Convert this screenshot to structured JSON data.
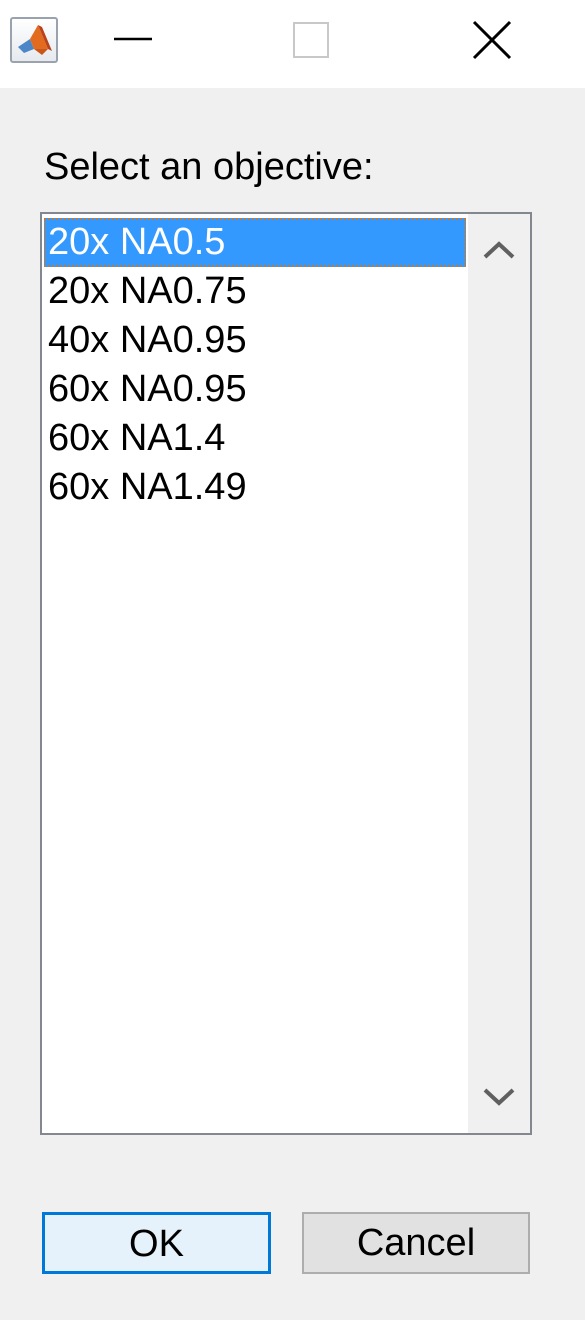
{
  "titlebar": {
    "app_icon": "matlab-logo-icon",
    "minimize_icon": "minimize-icon",
    "maximize_icon": "maximize-icon",
    "close_icon": "close-icon"
  },
  "dialog": {
    "prompt": "Select an objective:",
    "list": {
      "items": [
        "20x NA0.5",
        "20x NA0.75",
        "40x NA0.95",
        "60x NA0.95",
        "60x NA1.4",
        "60x NA1.49"
      ],
      "selected_index": 0
    },
    "scrollbar": {
      "up_icon": "chevron-up-icon",
      "down_icon": "chevron-down-icon"
    },
    "buttons": {
      "ok": "OK",
      "cancel": "Cancel"
    }
  },
  "colors": {
    "selection": "#3399ff",
    "default_button_border": "#0078d7",
    "window_background": "#f0f0f0"
  }
}
